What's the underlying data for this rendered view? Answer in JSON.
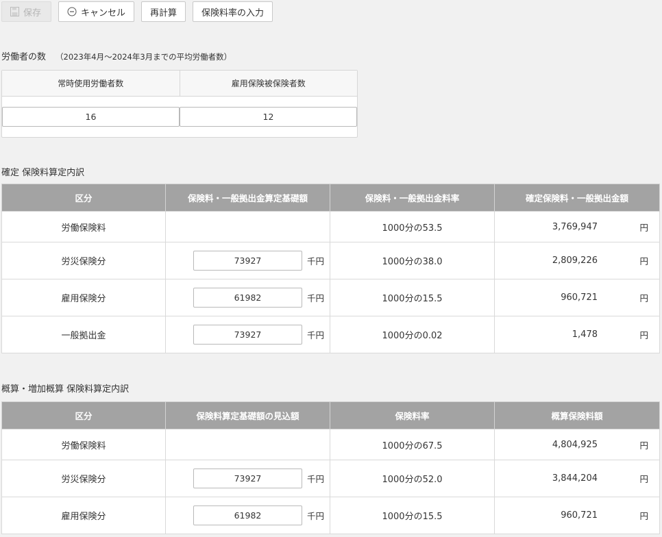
{
  "toolbar": {
    "save_label": "保存",
    "cancel_label": "キャンセル",
    "recalc_label": "再計算",
    "rate_input_label": "保険料率の入力"
  },
  "workers": {
    "title": "労働者の数",
    "note": "（2023年4月～2024年3月までの平均労働者数）",
    "regular_label": "常時使用労働者数",
    "regular_value": "16",
    "insured_label": "雇用保険被保険者数",
    "insured_value": "12"
  },
  "confirmed": {
    "title": "確定 保険料算定内訳",
    "headers": [
      "区分",
      "保険料・一般拠出金算定基礎額",
      "保険料・一般拠出金料率",
      "確定保険料・一般拠出金額"
    ],
    "rows": [
      {
        "category": "労働保険料",
        "base": "",
        "unit": "",
        "rate": "1000分の53.5",
        "amount": "3,769,947",
        "yen": "円"
      },
      {
        "category": "労災保険分",
        "base": "73927",
        "unit": "千円",
        "rate": "1000分の38.0",
        "amount": "2,809,226",
        "yen": "円"
      },
      {
        "category": "雇用保険分",
        "base": "61982",
        "unit": "千円",
        "rate": "1000分の15.5",
        "amount": "960,721",
        "yen": "円"
      },
      {
        "category": "一般拠出金",
        "base": "73927",
        "unit": "千円",
        "rate": "1000分の0.02",
        "amount": "1,478",
        "yen": "円"
      }
    ]
  },
  "estimate": {
    "title": "概算・増加概算 保険料算定内訳",
    "headers": [
      "区分",
      "保険料算定基礎額の見込額",
      "保険料率",
      "概算保険料額"
    ],
    "rows": [
      {
        "category": "労働保険料",
        "base": "",
        "unit": "",
        "rate": "1000分の67.5",
        "amount": "4,804,925",
        "yen": "円"
      },
      {
        "category": "労災保険分",
        "base": "73927",
        "unit": "千円",
        "rate": "1000分の52.0",
        "amount": "3,844,204",
        "yen": "円"
      },
      {
        "category": "雇用保険分",
        "base": "61982",
        "unit": "千円",
        "rate": "1000分の15.5",
        "amount": "960,721",
        "yen": "円"
      }
    ]
  },
  "icons": {
    "save": "save-disk-icon",
    "cancel": "minus-circle-icon"
  },
  "colors": {
    "table_header": "#a3a3a3",
    "background": "#f1f1f1"
  }
}
